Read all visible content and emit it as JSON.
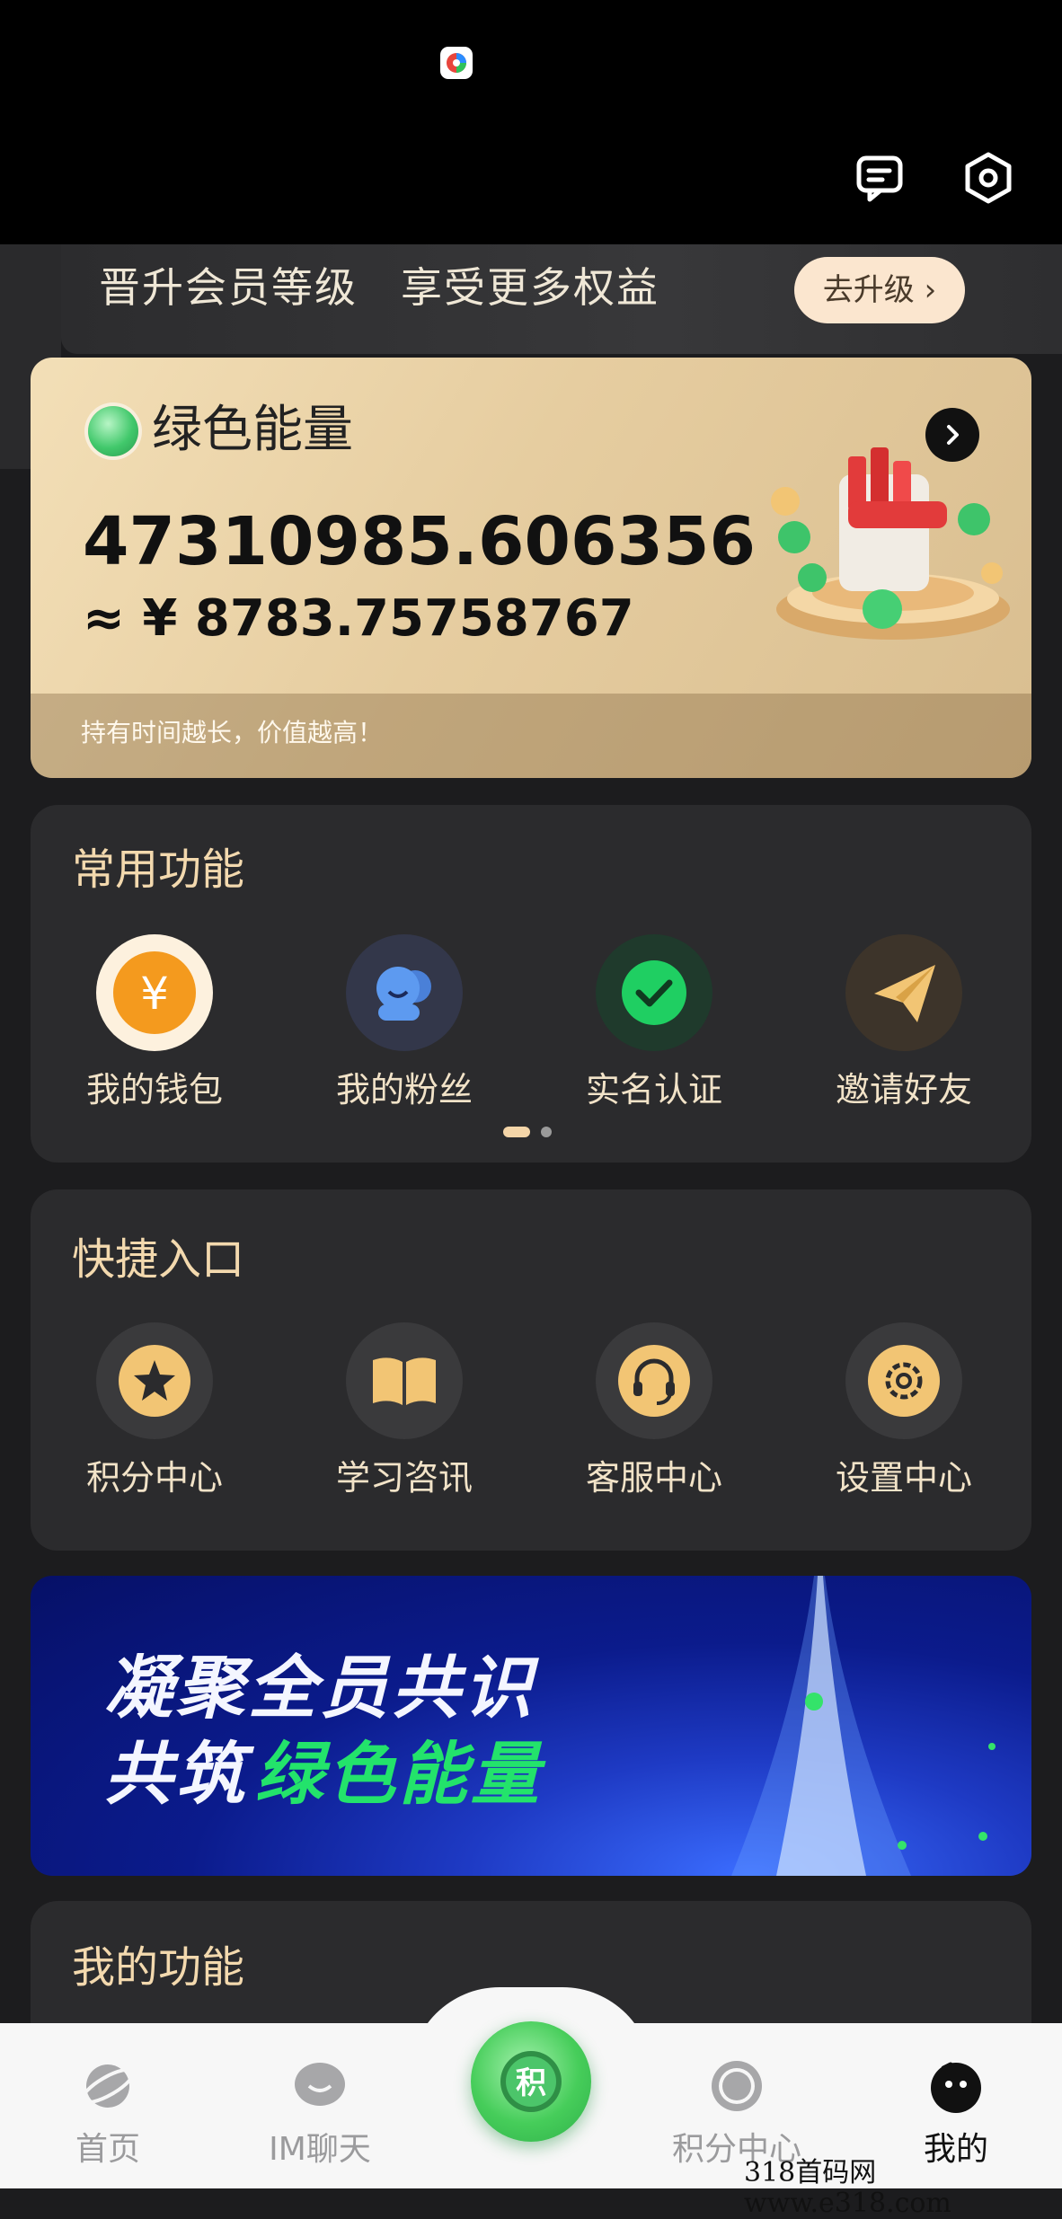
{
  "member_banner": {
    "text": "晋升会员等级　享受更多权益",
    "upgrade_label": "去升级 ›"
  },
  "energy_card": {
    "title": "绿色能量",
    "amount": "47310985.606356",
    "cny": "≈ ¥ 8783.75758767",
    "footer": "持有时间越长，价值越高！"
  },
  "common_functions": {
    "title": "常用功能",
    "items": [
      {
        "label": "我的钱包",
        "icon": "yuan-coin-icon"
      },
      {
        "label": "我的粉丝",
        "icon": "fans-icon"
      },
      {
        "label": "实名认证",
        "icon": "check-icon"
      },
      {
        "label": "邀请好友",
        "icon": "paper-plane-icon"
      }
    ]
  },
  "quick_entries": {
    "title": "快捷入口",
    "items": [
      {
        "label": "积分中心",
        "icon": "star-icon"
      },
      {
        "label": "学习咨讯",
        "icon": "book-icon"
      },
      {
        "label": "客服中心",
        "icon": "headset-icon"
      },
      {
        "label": "设置中心",
        "icon": "gear-icon"
      }
    ]
  },
  "promo": {
    "line1": "凝聚全员共识",
    "line2_white": "共筑",
    "line2_green": "绿色能量"
  },
  "my_functions": {
    "title": "我的功能"
  },
  "tabbar": {
    "items": [
      {
        "label": "首页",
        "icon": "planet-icon"
      },
      {
        "label": "IM聊天",
        "icon": "chat-bubble-icon"
      },
      {
        "label": "",
        "icon": "points-coin-icon"
      },
      {
        "label": "积分中心",
        "icon": "points-icon"
      },
      {
        "label": "我的",
        "icon": "profile-icon"
      }
    ],
    "center_char": "积"
  },
  "watermark": "318首码网  www.e318.com",
  "colors": {
    "accent_gold": "#f3d9ae",
    "card_bg": "#2b2b2d",
    "green": "#23e36b"
  }
}
